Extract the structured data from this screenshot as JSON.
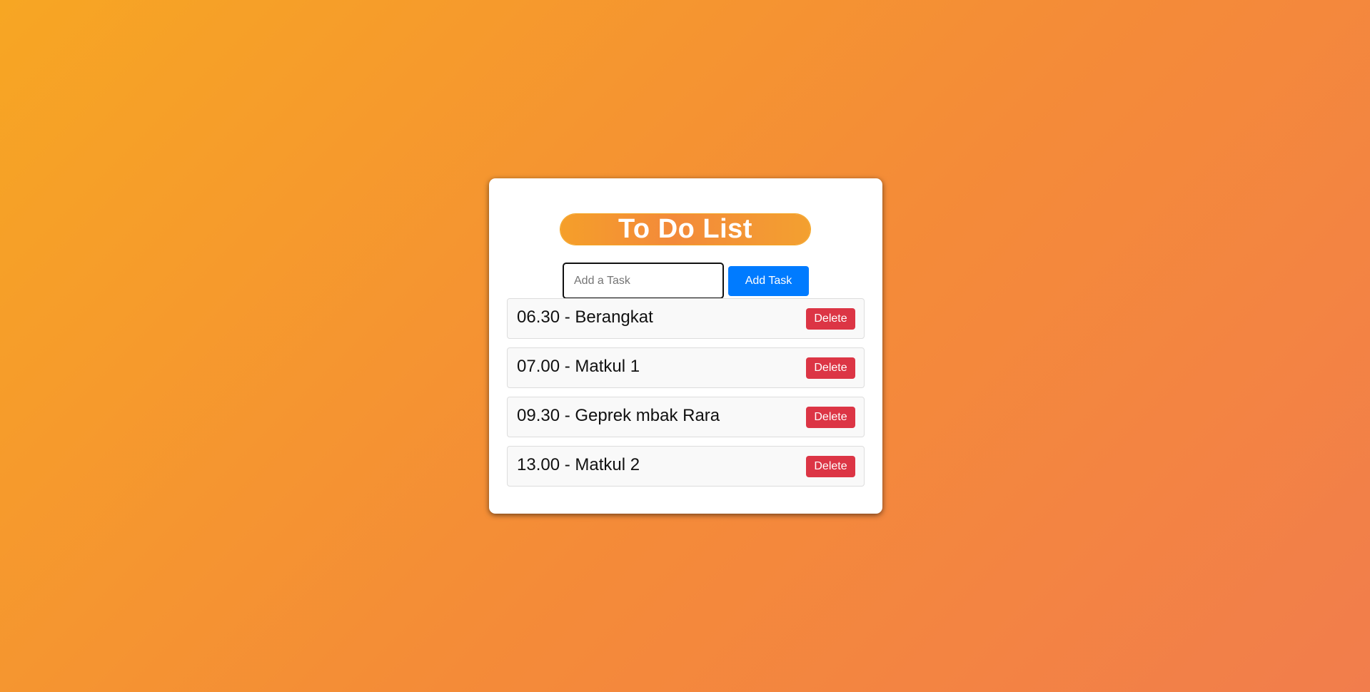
{
  "app": {
    "title": "To Do List"
  },
  "input": {
    "placeholder": "Add a Task",
    "value": ""
  },
  "add_button": {
    "label": "Add Task"
  },
  "tasks": [
    {
      "text": "06.30 - Berangkat",
      "delete_label": "Delete"
    },
    {
      "text": "07.00 - Matkul 1",
      "delete_label": "Delete"
    },
    {
      "text": "09.30 - Geprek mbak Rara",
      "delete_label": "Delete"
    },
    {
      "text": "13.00 - Matkul 2",
      "delete_label": "Delete"
    }
  ],
  "colors": {
    "background_start": "#f7a623",
    "background_end": "#f27d4c",
    "add_button": "#007bff",
    "delete_button": "#dc3545",
    "card": "#ffffff"
  }
}
